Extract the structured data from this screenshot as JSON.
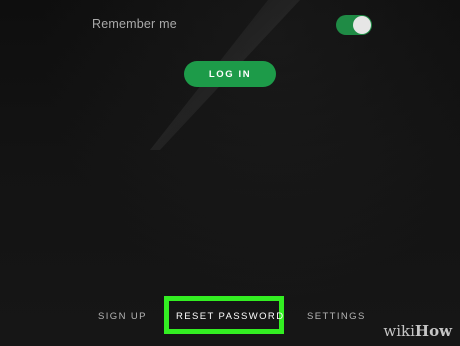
{
  "remember_me": {
    "label": "Remember me",
    "toggle_on": true
  },
  "login": {
    "label": "LOG IN"
  },
  "bottom_nav": {
    "signup": "SIGN UP",
    "reset_password": "RESET PASSWORD",
    "settings": "SETTINGS"
  },
  "watermark": {
    "wiki": "wiki",
    "how": "How"
  },
  "colors": {
    "accent_green": "#1d9b49",
    "highlight_green": "#33ee22",
    "background": "#121212"
  }
}
